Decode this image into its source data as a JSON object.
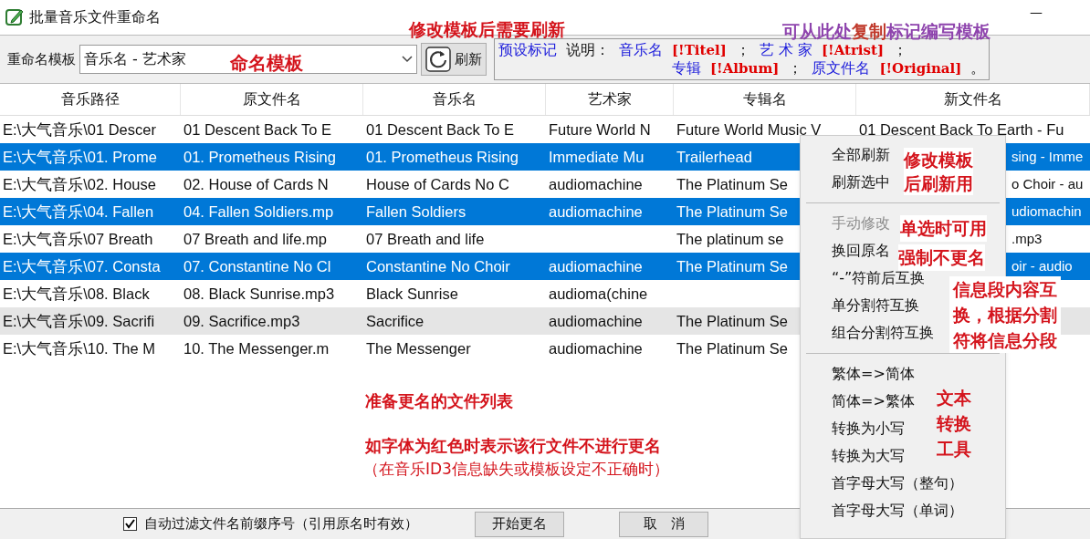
{
  "window": {
    "title": "批量音乐文件重命名",
    "minimize": "—"
  },
  "toolbar": {
    "template_label": "重命名模板",
    "template_value": "音乐名 - 艺术家",
    "refresh_button": "刷新",
    "preset_lines": [
      [
        {
          "kind": "label",
          "text": "预设标记"
        },
        {
          "kind": "plain",
          "text": "说明："
        },
        {
          "kind": "label",
          "text": "音乐名"
        },
        {
          "kind": "tag",
          "text": "[!Titel]"
        },
        {
          "kind": "plain",
          "text": "；"
        },
        {
          "kind": "label",
          "text": "艺 术 家"
        },
        {
          "kind": "tag",
          "text": "[!Atrist]"
        },
        {
          "kind": "plain",
          "text": "；"
        }
      ],
      [
        {
          "kind": "label",
          "text": "专辑"
        },
        {
          "kind": "tag",
          "text": "[!Album]"
        },
        {
          "kind": "plain",
          "text": "；"
        },
        {
          "kind": "label",
          "text": "原文件名"
        },
        {
          "kind": "tag",
          "text": "[!Original]"
        },
        {
          "kind": "plain",
          "text": "。"
        }
      ]
    ]
  },
  "table": {
    "columns": [
      "音乐路径",
      "原文件名",
      "音乐名",
      "艺术家",
      "专辑名",
      "新文件名"
    ],
    "rows": [
      {
        "selected": false,
        "hovered": false,
        "cells": [
          "E:\\大气音乐\\01 Descer",
          "01 Descent Back To E",
          "01 Descent Back To E",
          "Future World N",
          "Future World Music V",
          "01 Descent Back To Earth - Fu"
        ]
      },
      {
        "selected": true,
        "hovered": false,
        "cells": [
          "E:\\大气音乐\\01. Prome",
          "01. Prometheus Rising",
          "01. Prometheus Rising",
          "Immediate Mu",
          "Trailerhead",
          "sing - Imme"
        ]
      },
      {
        "selected": false,
        "hovered": false,
        "cells": [
          "E:\\大气音乐\\02. House",
          "02. House of Cards N",
          "House of Cards No C",
          "audiomachine",
          "The Platinum Se",
          "o Choir - au"
        ]
      },
      {
        "selected": true,
        "hovered": false,
        "cells": [
          "E:\\大气音乐\\04. Fallen",
          "04. Fallen Soldiers.mp",
          "Fallen Soldiers",
          "audiomachine",
          "The Platinum Se",
          "udiomachin"
        ]
      },
      {
        "selected": false,
        "hovered": false,
        "cells": [
          "E:\\大气音乐\\07 Breath",
          "07 Breath and life.mp",
          "07 Breath and life",
          "",
          "The platinum se",
          ".mp3"
        ]
      },
      {
        "selected": true,
        "hovered": false,
        "cells": [
          "E:\\大气音乐\\07. Consta",
          "07. Constantine No Cl",
          "Constantine No Choir",
          "audiomachine",
          "The Platinum Se",
          "oir - audio"
        ]
      },
      {
        "selected": false,
        "hovered": false,
        "cells": [
          "E:\\大气音乐\\08. Black",
          "08. Black Sunrise.mp3",
          "Black Sunrise",
          "audioma(chine",
          "",
          ""
        ]
      },
      {
        "selected": false,
        "hovered": true,
        "cells": [
          "E:\\大气音乐\\09. Sacrifi",
          "09. Sacrifice.mp3",
          "Sacrifice",
          "audiomachine",
          "The Platinum Se",
          ""
        ]
      },
      {
        "selected": false,
        "hovered": false,
        "cells": [
          "E:\\大气音乐\\10. The M",
          "10. The Messenger.m",
          "The Messenger",
          "audiomachine",
          "The Platinum Se",
          ""
        ]
      }
    ]
  },
  "context_menu": [
    {
      "kind": "item",
      "label": "全部刷新",
      "disabled": false
    },
    {
      "kind": "item",
      "label": "刷新选中",
      "disabled": false
    },
    {
      "kind": "separator"
    },
    {
      "kind": "item",
      "label": "手动修改",
      "disabled": true
    },
    {
      "kind": "item",
      "label": "换回原名",
      "disabled": false
    },
    {
      "kind": "item",
      "label": "“-”符前后互换",
      "disabled": false
    },
    {
      "kind": "item",
      "label": "单分割符互换",
      "disabled": false
    },
    {
      "kind": "item",
      "label": "组合分割符互换",
      "disabled": false
    },
    {
      "kind": "separator"
    },
    {
      "kind": "item",
      "label": "繁体=>简体",
      "disabled": false
    },
    {
      "kind": "item",
      "label": "简体=>繁体",
      "disabled": false
    },
    {
      "kind": "item",
      "label": "转换为小写",
      "disabled": false
    },
    {
      "kind": "item",
      "label": "转换为大写",
      "disabled": false
    },
    {
      "kind": "item",
      "label": "首字母大写（整句）",
      "disabled": false
    },
    {
      "kind": "item",
      "label": "首字母大写（单词）",
      "disabled": false
    }
  ],
  "bottom_bar": {
    "auto_filter": {
      "label": "自动过滤文件名前缀序号（引用原名时有效）",
      "checked": true
    },
    "buttons": [
      "开始更名",
      "取　消"
    ]
  },
  "annotations": [
    {
      "lines": [
        "修改模板后需要刷新"
      ]
    },
    {
      "segments": [
        {
          "text": "可从此处",
          "color": "#8e44ad"
        },
        {
          "text": "复制",
          "color": "#c0392b"
        },
        {
          "text": "标记编写模板",
          "color": "#8e44ad"
        }
      ]
    },
    {
      "lines": [
        "命名模板"
      ]
    },
    {
      "lines": [
        "修改模板",
        "后刷新用"
      ]
    },
    {
      "lines": [
        "单选时可用"
      ]
    },
    {
      "lines": [
        "强制不更名"
      ]
    },
    {
      "lines": [
        "信息段内容互",
        "换，根据分割",
        "符将信息分段"
      ]
    },
    {
      "lines": [
        "准备更名的文件列表"
      ]
    },
    {
      "lines": [
        "如字体为红色时表示该行文件不进行更名"
      ]
    },
    {
      "lines": [
        "（在音乐ID3信息缺失或模板设定不正确时）"
      ],
      "bold": false
    },
    {
      "lines": [
        "文本",
        "转换",
        "工具"
      ]
    }
  ]
}
